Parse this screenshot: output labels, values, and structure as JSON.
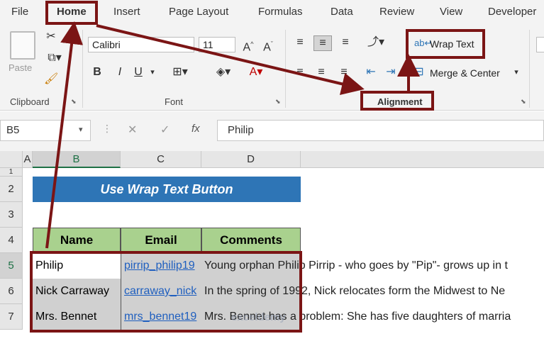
{
  "ribbon_tabs": [
    "File",
    "Home",
    "Insert",
    "Page Layout",
    "Formulas",
    "Data",
    "Review",
    "View",
    "Developer"
  ],
  "clipboard": {
    "paste_label": "Paste",
    "group_label": "Clipboard"
  },
  "font": {
    "name": "Calibri",
    "size": "11",
    "group_label": "Font",
    "bold": "B",
    "italic": "I",
    "underline": "U"
  },
  "alignment": {
    "wrap_text_label": "Wrap Text",
    "merge_center_label": "Merge & Center",
    "group_label": "Alignment"
  },
  "formula_bar": {
    "name_box": "B5",
    "fx": "fx",
    "value": "Philip"
  },
  "columns": [
    "A",
    "B",
    "C",
    "D"
  ],
  "rows": [
    "1",
    "2",
    "3",
    "4",
    "5",
    "6",
    "7"
  ],
  "sheet": {
    "title": "Use Wrap Text Button",
    "headers": [
      "Name",
      "Email",
      "Comments"
    ],
    "data": [
      {
        "name": "Philip",
        "email": "pirrip_philip19",
        "comment": "Young orphan Philip Pirrip - who goes by \"Pip\"- grows up in t"
      },
      {
        "name": "Nick Carraway",
        "email": "carraway_nick",
        "comment": "In the spring of 1992, Nick relocates form the Midwest to Ne"
      },
      {
        "name": "Mrs. Bennet",
        "email": "mrs_bennet19",
        "comment": "Mrs. Bennet has a problem: She has five daughters of marria"
      }
    ]
  },
  "colors": {
    "title_bg": "#2e75b6",
    "header_bg": "#a9d18e",
    "row_bg": "#d0d0d0",
    "highlight": "#7b1515",
    "link": "#1f5fbf"
  },
  "watermark": "exceldemy"
}
